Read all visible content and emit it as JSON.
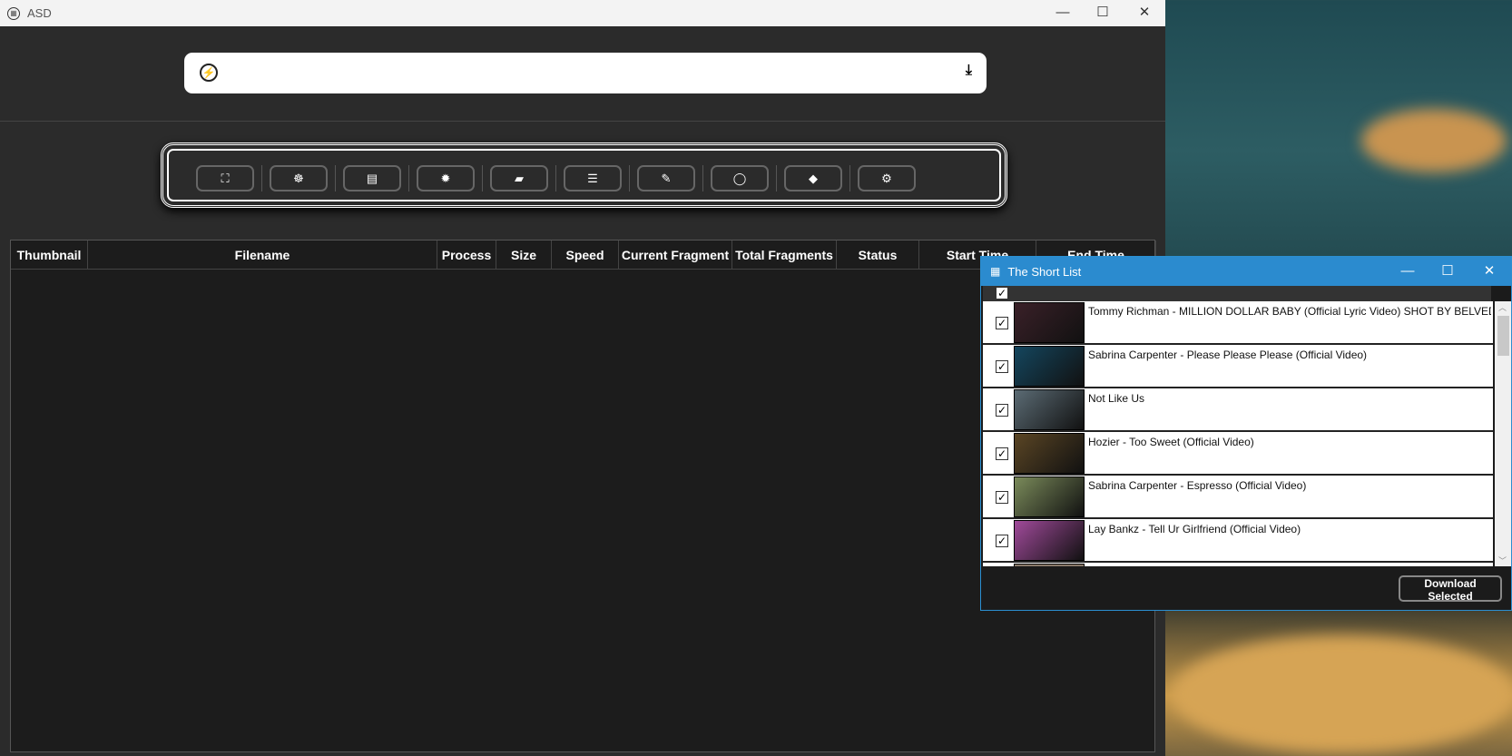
{
  "main_window": {
    "title": "ASD",
    "url_value": "",
    "url_placeholder": ""
  },
  "toolbar": {
    "buttons": [
      {
        "name": "hd-button",
        "icon": "hd-scan-icon",
        "glyph": "⛶"
      },
      {
        "name": "cookie-button",
        "icon": "cookie-icon",
        "glyph": "☸"
      },
      {
        "name": "file-button",
        "icon": "file-icon",
        "glyph": "▤"
      },
      {
        "name": "settings-button",
        "icon": "gear-icon",
        "glyph": "✹"
      },
      {
        "name": "book-button",
        "icon": "book-icon",
        "glyph": "▰"
      },
      {
        "name": "list-button",
        "icon": "server-list-icon",
        "glyph": "☰"
      },
      {
        "name": "edit-button",
        "icon": "edit-icon",
        "glyph": "✎"
      },
      {
        "name": "record-button",
        "icon": "circle-icon",
        "glyph": "◯"
      },
      {
        "name": "tag-button",
        "icon": "tag-icon",
        "glyph": "◆"
      },
      {
        "name": "advanced-settings-button",
        "icon": "gears-icon",
        "glyph": "⚙"
      }
    ]
  },
  "table": {
    "columns": [
      "Thumbnail",
      "Filename",
      "Process",
      "Size",
      "Speed",
      "Current Fragment",
      "Total Fragments",
      "Status",
      "Start Time",
      "End Time"
    ]
  },
  "short_list": {
    "title": "The Short List",
    "download_label": "Download Selected",
    "items": [
      {
        "title": "Tommy Richman - MILLION DOLLAR BABY (Official Lyric Video) SHOT BY BELVEDERE",
        "checked": true,
        "thumb": "#3a2028"
      },
      {
        "title": "Sabrina Carpenter - Please Please Please (Official Video)",
        "checked": true,
        "thumb": "#14465e"
      },
      {
        "title": "Not Like Us",
        "checked": true,
        "thumb": "#5b6b74"
      },
      {
        "title": "Hozier - Too Sweet (Official Video)",
        "checked": true,
        "thumb": "#5a4524"
      },
      {
        "title": "Sabrina Carpenter - Espresso (Official Video)",
        "checked": true,
        "thumb": "#7a8a5a"
      },
      {
        "title": "Lay Bankz - Tell Ur Girlfriend (Official Video)",
        "checked": true,
        "thumb": "#a04a9a"
      }
    ]
  }
}
